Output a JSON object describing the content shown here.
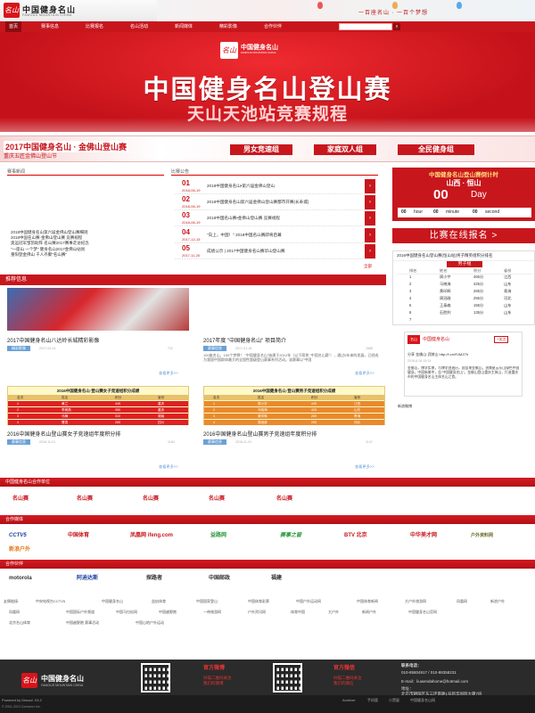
{
  "header": {
    "logo_mark": "名山",
    "logo_cn": "中国健身名山",
    "logo_en": "FAMOUS MOUNTAIN CHINA",
    "slogan": "一百座名山 · 一百个梦想"
  },
  "nav": {
    "items": [
      "首页",
      "赛事信息",
      "比赛报名",
      "名山活动",
      "新闻媒体",
      "精彩影像",
      "合作伙伴"
    ],
    "search_placeholder": "",
    "search_button": "搜索"
  },
  "banner1": {
    "logo_cn": "中国健身名山",
    "logo_en": "FAMOUS MOUNTAIN CHINA",
    "title": "中国健身名山登山赛",
    "subtitle": "天山天池站竞赛规程"
  },
  "banner2": {
    "title": "2017中国健身名山 · 金佛山登山赛",
    "subtitle": "重庆五匠金佛山登山节",
    "chips": [
      "男女竞速组",
      "家庭双人组",
      "全民健身组"
    ]
  },
  "news": {
    "head": "赛事新闻",
    "items": [
      "2018中国健身名山第六届金佛山登山赛细则",
      "2018中国名山赛·金佛山登山赛 竞赛规程",
      "奥运冠军邹凯助阵 名山赛2017赛事走访纪念",
      "\"一座山 一个梦\" 健身名山2017金佛山站尚",
      "重阳登金佛山 千人齐聚\"名山赛\""
    ]
  },
  "notices": {
    "head": "比赛公告",
    "more": "全部",
    "items": [
      {
        "num": "01",
        "date": "2018-06-19",
        "text": "2018中国健身名山•第六届金佛山登山"
      },
      {
        "num": "02",
        "date": "2018-06-19",
        "text": "2018中国健身名山第六届金佛山登山赛都市开赛(长寿城)"
      },
      {
        "num": "03",
        "date": "2018-06-19",
        "text": "2018中国名山赛•金佛山登山赛 竞赛规程"
      },
      {
        "num": "04",
        "date": "2017-12-15",
        "text": "\"向上，中国！\" 2018中国名山赛即将启幕"
      },
      {
        "num": "05",
        "date": "2017-11-20",
        "text": "成绩公示 | 2017中国健身名山赛华山登山赛"
      }
    ]
  },
  "countdown": {
    "title": "中国健身名山登山赛倒计时",
    "place": "山西 · 恒山",
    "days": "00",
    "day_label": "Day",
    "hour": "00",
    "hour_label": "hour",
    "minute": "00",
    "minute_label": "minute",
    "second": "00",
    "second_label": "second",
    "enroll_button": "比赛在线报名 >"
  },
  "ranking": {
    "title": "2016中国健身名山登山赛(恒山站)男子精英组积分排名",
    "tab": "男子组",
    "head": [
      "排名",
      "姓名",
      "积分",
      "省份"
    ],
    "rows": [
      [
        "1",
        "周小宇",
        "465分",
        "江西"
      ],
      [
        "2",
        "马晓海",
        "425分",
        "山东"
      ],
      [
        "3",
        "黄印辉",
        "265分",
        "青海"
      ],
      [
        "4",
        "周冠政",
        "255分",
        "河北"
      ],
      [
        "5",
        "王泰森",
        "155分",
        "山东"
      ],
      [
        "6",
        "石胜利",
        "135分",
        "山东"
      ],
      [
        "7",
        "",
        "",
        ""
      ]
    ]
  },
  "featured": {
    "head": "推荐信息",
    "cards": [
      {
        "title": "2017中国健身名山八达岭长城精彩影像",
        "tag": "精彩影像",
        "date": "2017-04-14",
        "views": "722"
      },
      {
        "title": "2017年度 \"中国健身名山\" 项目简介",
        "tag": "赛事信息",
        "date": "2017-01-18",
        "views": "1586",
        "desc": "100座名山、100个梦想！ \"中国健身名山\"始建于2012年（以下简称 \"中国名山赛\"），通过5年来的发展，已经成为我国中国群体最大的全国性超级登山赛事系列活动。该赛事以\"中国"
      },
      {
        "title": "2016中国健身名山登山赛女子竞速组年度积分排",
        "tag": "赛事信息",
        "date": "2016-11-01",
        "views": "1184",
        "table_title": "2016中国健身名山·登山赛女子竞速组积分成绩",
        "cols": [
          "名次",
          "姓名",
          "积分",
          "省份"
        ],
        "rows": [
          [
            "1",
            "黄兰",
            "445",
            "重庆"
          ],
          [
            "2",
            "李美燕",
            "350",
            "重庆"
          ],
          [
            "3",
            "马梅",
            "310",
            "湖南"
          ],
          [
            "4",
            "曹雯",
            "285",
            "四川"
          ]
        ],
        "more": "查看更多>>"
      },
      {
        "title": "2016中国健身名山登山赛男子竞速组年度积分排",
        "tag": "赛事信息",
        "date": "2016-11-01",
        "views": "1147",
        "table_title": "2016中国健身名山·登山赛男子竞速组积分成绩",
        "cols": [
          "名次",
          "姓名",
          "积分",
          "省份"
        ],
        "rows": [
          [
            "1",
            "周小宇",
            "445",
            "江西"
          ],
          [
            "2",
            "马晓海",
            "425",
            "山东"
          ],
          [
            "3",
            "黄印辉",
            "265",
            "青海"
          ],
          [
            "4",
            "周冠政",
            "255",
            "河北"
          ]
        ],
        "more": "查看更多>>"
      }
    ],
    "more_1": "查看更多>>",
    "more_2": "查看更多>>"
  },
  "weibo": {
    "name": "中国健身名山",
    "follow": "+关注",
    "post": "分享 金佛山·武陵山 http://t.cn/RJMZ7h",
    "date": "2018-6-26 15:14",
    "post2": "金佛山，博学实景，与博学创造历，国宝来金佛山，创美星云乐山绿色中国健身。中国新美中，告\"中国健身名山\"。金佛山登山重庆主体山，打造重庆市的中国健身名山主体名山之首。",
    "link": "新浪微博"
  },
  "sponsors": {
    "head": "中国健身名山合作单位",
    "logo_text": "名山赛"
  },
  "media": {
    "head": "合作媒体",
    "logos": [
      "CCTV5",
      "中国体育",
      "凤凰网 ifeng.com",
      "益路网",
      "赛事之窗",
      "BTV 北京",
      "中华美才网",
      "户外资料网",
      "新浪户外"
    ]
  },
  "partners": {
    "head": "合作伙伴",
    "logos": [
      "motorola",
      "阿迪达斯",
      "探路者",
      "中国邮政",
      "福建"
    ]
  },
  "links": {
    "label": "友情链接:",
    "items": [
      "中央电视台CCTV5",
      "中国健身名山",
      "益启体育",
      "中国国家登山",
      "中国体育彩票",
      "中国户外运动网",
      "中国体育新闻",
      "大户外旅游网",
      "凤凰网",
      "新浪户外",
      "凤凰网",
      "中国国际户外频道",
      "中国马拉松网",
      "中国越野跑",
      "一带旅游网",
      "户外资讯网",
      "体育中国",
      "大户外",
      "新闻户外",
      "中国健身名山官网",
      "北京名山体育",
      "中国越野跑 赛事活动",
      "中国山地户外运动"
    ]
  },
  "footer": {
    "logo_cn": "中国健身名山",
    "logo_en": "FAMOUS MOUNTAIN CHINA",
    "weibo_head": "官方微博",
    "weibo_text1": "扫描二维码关注",
    "weibo_text2": "我们的微博",
    "wechat_head": "官方微信",
    "wechat_text1": "扫描二维码关注",
    "wechat_text2": "我们的微信",
    "contact_head": "联系电话：",
    "phone": "010-85804917 / 010-88358231",
    "email_label": "E-mail：liuwendahome@hotmail.com",
    "address_label": "地址：",
    "address": "北京市朝阳区东三环南路1号新华国际大厦7层",
    "powered": "Powered by Discuz! X3.2",
    "copyright": "© 2001-2013 Comsenz Inc.",
    "bottom_links": [
      "Archiver",
      "手机版",
      "小黑屋",
      "中国健身名山网"
    ]
  }
}
